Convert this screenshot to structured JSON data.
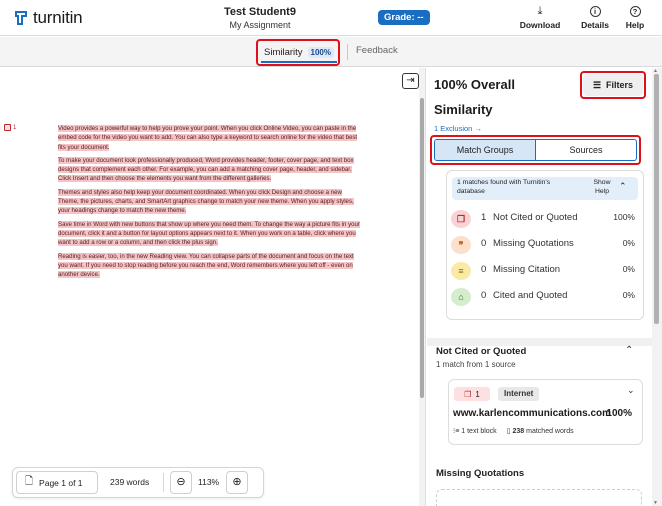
{
  "header": {
    "logo_text": "turnitin",
    "student_name": "Test Student9",
    "assignment": "My Assignment",
    "grade_label": "Grade: --",
    "actions": [
      {
        "label": "Download",
        "icon": "download-icon"
      },
      {
        "label": "Details",
        "icon": "info-icon"
      },
      {
        "label": "Help",
        "icon": "help-icon"
      }
    ]
  },
  "tabs": {
    "similarity_label": "Similarity",
    "similarity_badge": "100%",
    "feedback_label": "Feedback"
  },
  "document": {
    "flag_count": "1",
    "paragraphs": [
      "Video provides a powerful way to help you prove your point. When you click Online Video, you can paste in the embed code for the video you want to add. You can also type a keyword to search online for the video that best fits your document.",
      "To make your document look professionally produced, Word provides header, footer, cover page, and text box designs that complement each other. For example, you can add a matching cover page, header, and sidebar. Click Insert and then choose the elements you want from the different galleries.",
      "Themes and styles also help keep your document coordinated. When you click Design and choose a new Theme, the pictures, charts, and SmartArt graphics change to match your new theme. When you apply styles, your headings change to match the new theme.",
      "Save time in Word with new buttons that show up where you need them. To change the way a picture fits in your document, click it and a button for layout options appears next to it. When you work on a table, click where you want to add a row or a column, and then click the plus sign.",
      "Reading is easier, too, in the new Reading view. You can collapse parts of the document and focus on the text you want. If you need to stop reading before you reach the end, Word remembers where you left off - even on another device."
    ],
    "page_indicator": "Page 1 of 1",
    "word_count": "239 words",
    "zoom_level": "113%"
  },
  "panel": {
    "overall": "100% Overall",
    "filters_label": "Filters",
    "similarity_title": "Similarity",
    "exclusion_link": "1 Exclusion",
    "segments": {
      "match_groups": "Match Groups",
      "sources": "Sources"
    },
    "info_text": "1 matches found with Turnitin's database",
    "show_help": "Show Help",
    "match_groups": [
      {
        "count": "1",
        "label": "Not Cited or Quoted",
        "percent": "100%",
        "icon": "copy-icon",
        "color": "#f9d3d3",
        "icon_color": "#c0262d"
      },
      {
        "count": "0",
        "label": "Missing Quotations",
        "percent": "0%",
        "icon": "quote-icon",
        "color": "#fde0cc",
        "icon_color": "#c2561a"
      },
      {
        "count": "0",
        "label": "Missing Citation",
        "percent": "0%",
        "icon": "lines-icon",
        "color": "#faeaa8",
        "icon_color": "#8a6a00"
      },
      {
        "count": "0",
        "label": "Cited and Quoted",
        "percent": "0%",
        "icon": "graduation-cap-icon",
        "color": "#d5edcf",
        "icon_color": "#2d6b26"
      }
    ],
    "ncq_section": {
      "title": "Not Cited or Quoted",
      "subtitle": "1 match from 1 source",
      "source": {
        "count": "1",
        "type": "Internet",
        "url": "www.karlencommunications.com",
        "percent": "100%",
        "text_blocks": "1 text block",
        "matched_words_count": "238",
        "matched_words_label": "matched words"
      }
    },
    "missing_quotations_title": "Missing Quotations"
  },
  "colors": {
    "accent": "#1a6ec2",
    "highlight": "#f6c4c7",
    "annotation_red": "#e0101a"
  }
}
